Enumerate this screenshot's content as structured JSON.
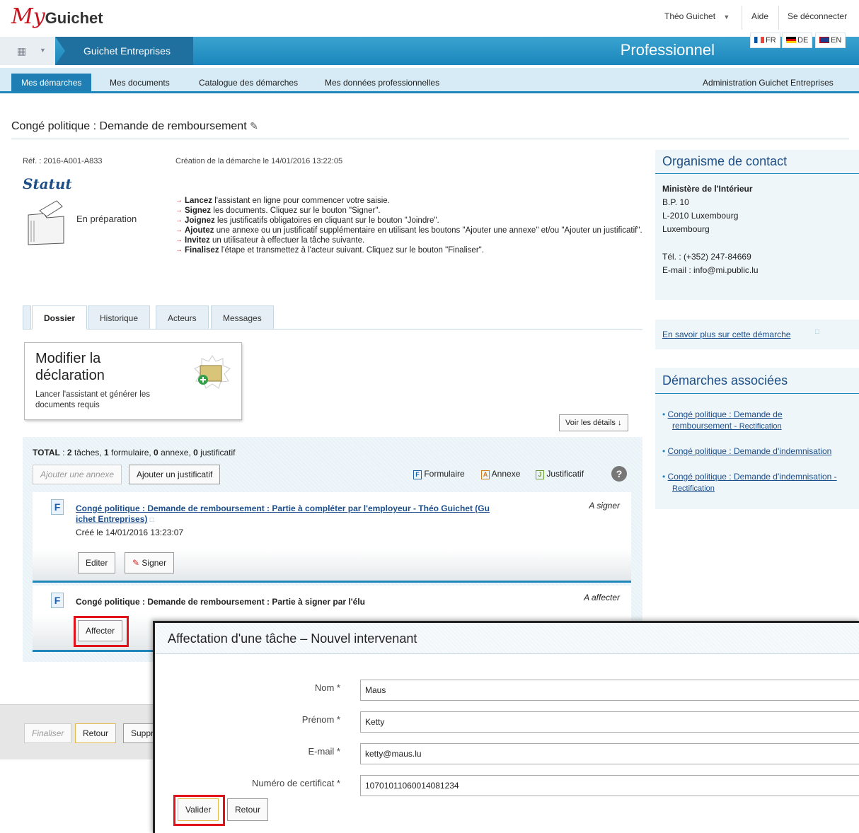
{
  "header": {
    "logo_my": "My",
    "logo_rest": "Guichet",
    "user_name": "Théo Guichet",
    "help": "Aide",
    "logout": "Se déconnecter",
    "languages": [
      "FR",
      "DE",
      "EN"
    ],
    "app_name": "Guichet Entreprises",
    "space": "Professionnel"
  },
  "menu": {
    "items": [
      "Mes démarches",
      "Mes documents",
      "Catalogue des démarches",
      "Mes données professionnelles"
    ],
    "admin": "Administration Guichet Entreprises"
  },
  "page": {
    "title": "Congé politique : Demande de remboursement",
    "ref": "Réf. : 2016-A001-A833",
    "created": "Création de la démarche le 14/01/2016 13:22:05",
    "statut_title": "Statut",
    "statut_value": "En préparation",
    "steps": [
      {
        "bold": "Lancez",
        "text": " l'assistant en ligne pour commencer votre saisie."
      },
      {
        "bold": "Signez",
        "text": " les documents. Cliquez sur le bouton \"Signer\"."
      },
      {
        "bold": "Joignez",
        "text": " les justificatifs obligatoires en cliquant sur le bouton \"Joindre\"."
      },
      {
        "bold": "Ajoutez",
        "text": " une annexe ou un justificatif supplémentaire en utilisant les boutons \"Ajouter une annexe\" et/ou \"Ajouter un justificatif\"."
      },
      {
        "bold": "Invitez",
        "text": " un utilisateur à effectuer la tâche suivante."
      },
      {
        "bold": "Finalisez",
        "text": " l'étape et transmettez à l'acteur suivant. Cliquez sur le bouton \"Finaliser\"."
      }
    ]
  },
  "tabs": [
    "Dossier",
    "Historique",
    "Acteurs",
    "Messages"
  ],
  "card": {
    "title_line1": "Modifier la",
    "title_line2": "déclaration",
    "desc_line1": "Lancer l'assistant et générer les",
    "desc_line2": "documents requis"
  },
  "details_button": "Voir les détails",
  "total": {
    "label": "TOTAL",
    "taches": "2",
    "taches_label": "tâches,",
    "formulaire": "1",
    "formulaire_label": "formulaire,",
    "annexe": "0",
    "annexe_label": "annexe,",
    "justificatif": "0",
    "justificatif_label": "justificatif"
  },
  "actions": {
    "add_annexe": "Ajouter une annexe",
    "add_justificatif": "Ajouter un justificatif",
    "legend_formulaire": "Formulaire",
    "legend_annexe": "Annexe",
    "legend_justificatif": "Justificatif"
  },
  "tasks": [
    {
      "title_line1": "Congé politique : Demande de remboursement : Partie à compléter par l'employeur - Théo Guichet (Gu",
      "title_line2": "ichet Entreprises)",
      "created": "Créé le 14/01/2016 13:23:07",
      "status": "A signer",
      "btn_edit": "Editer",
      "btn_sign": "Signer"
    },
    {
      "title": "Congé politique : Demande de remboursement : Partie à signer par l'élu",
      "status": "A affecter",
      "btn_assign": "Affecter"
    }
  ],
  "bottom": {
    "finaliser": "Finaliser",
    "retour": "Retour",
    "supprimer_partial": "Suppr"
  },
  "contact": {
    "title": "Organisme de contact",
    "org": "Ministère de l'Intérieur",
    "bp": "B.P. 10",
    "city": "L-2010 Luxembourg",
    "country": "Luxembourg",
    "tel": "Tél. : (+352) 247-84669",
    "email": "E-mail : info@mi.public.lu",
    "more": "En savoir plus sur cette démarche"
  },
  "associees": {
    "title": "Démarches associées",
    "items": [
      {
        "line1": "Congé politique : Demande de",
        "line2": "remboursement - ",
        "sub": "Rectification"
      },
      {
        "line1": "Congé politique : Demande d'indemnisation"
      },
      {
        "line1": "Congé politique : Demande d'indemnisation -",
        "sub": "Rectification"
      }
    ]
  },
  "modal": {
    "title": "Affectation d'une tâche – Nouvel intervenant",
    "fields": [
      {
        "label": "Nom *",
        "value": "Maus"
      },
      {
        "label": "Prénom *",
        "value": "Ketty"
      },
      {
        "label": "E-mail *",
        "value": "ketty@maus.lu"
      },
      {
        "label": "Numéro de certificat *",
        "value": "10701011060014081234"
      }
    ],
    "btn_validate": "Valider",
    "btn_back": "Retour"
  },
  "colors": {
    "accent": "#1f86bb",
    "brand_red": "#c8141e",
    "highlight": "#e0121a"
  }
}
